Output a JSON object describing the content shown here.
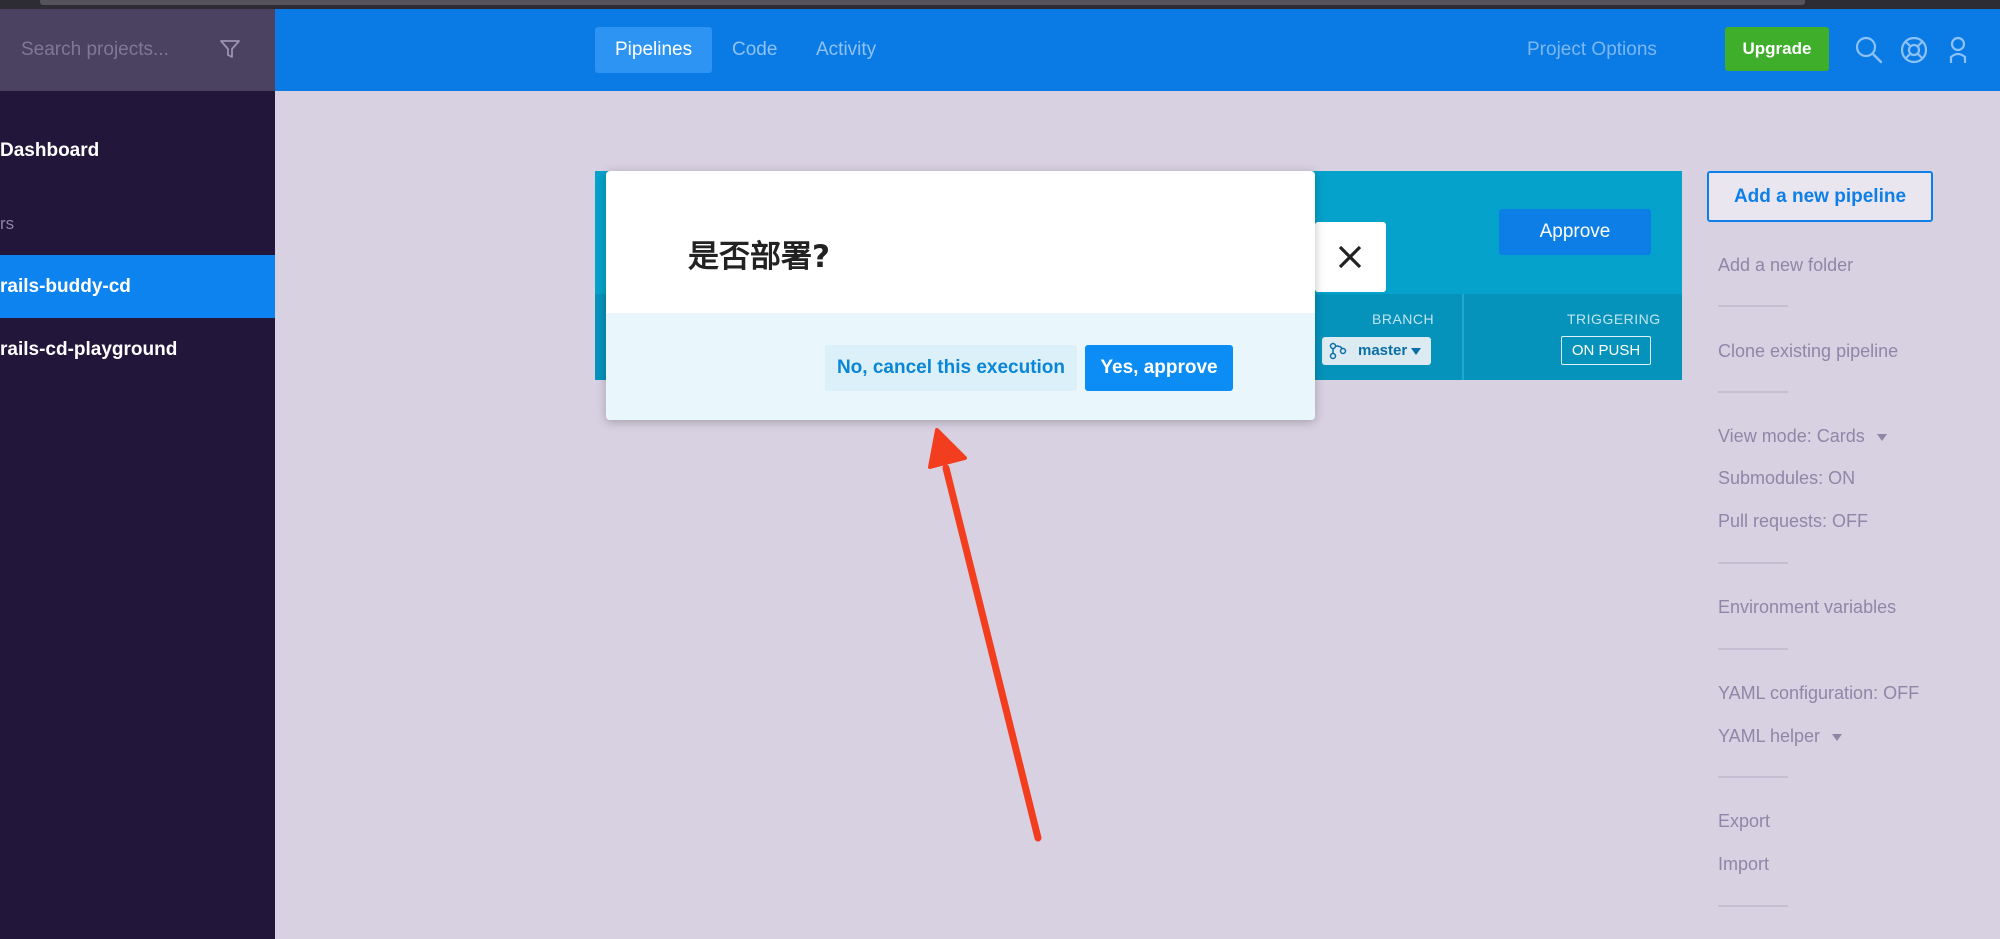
{
  "sidebar": {
    "search_placeholder": "Search projects...",
    "dashboard": "Dashboard",
    "section": "rs",
    "projects": [
      "rails-buddy-cd",
      "rails-cd-playground"
    ]
  },
  "topbar": {
    "tabs": [
      "Pipelines",
      "Code",
      "Activity"
    ],
    "project_options": "Project Options",
    "upgrade": "Upgrade"
  },
  "pipeline_card": {
    "approve": "Approve",
    "branch_label": "BRANCH",
    "branch": "master",
    "triggering_label": "TRIGGERING",
    "triggering": "ON PUSH"
  },
  "modal": {
    "title": "是否部署?",
    "cancel": "No, cancel this execution",
    "confirm": "Yes, approve"
  },
  "right_menu": {
    "add_pipeline": "Add a new pipeline",
    "add_folder": "Add a new folder",
    "clone": "Clone existing pipeline",
    "view_mode": "View mode: Cards",
    "submodules": "Submodules: ON",
    "pull_requests": "Pull requests: OFF",
    "env_vars": "Environment variables",
    "yaml_config": "YAML configuration: OFF",
    "yaml_helper": "YAML helper",
    "export": "Export",
    "import": "Import"
  },
  "colors": {
    "primary": "#0a7be5",
    "sidebar": "#23163b",
    "upgrade": "#3fae2a",
    "annotation": "#f23d1e"
  }
}
